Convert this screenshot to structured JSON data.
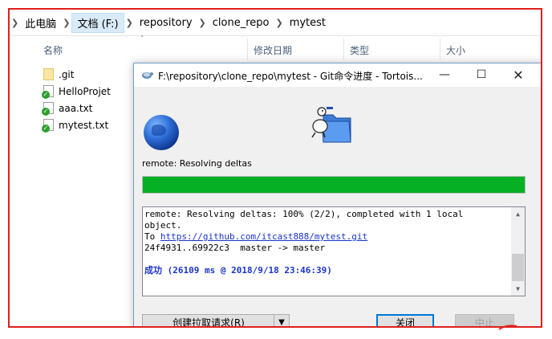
{
  "explorer": {
    "breadcrumbs": [
      "此电脑",
      "文档 (F:)",
      "repository",
      "clone_repo",
      "mytest"
    ],
    "columns": {
      "name": "名称",
      "date": "修改日期",
      "type": "类型",
      "size": "大小"
    },
    "files": [
      {
        "name": ".git",
        "icon": "folder-icon"
      },
      {
        "name": "HelloProjet",
        "icon": "file-ok-icon"
      },
      {
        "name": "aaa.txt",
        "icon": "file-ok-icon"
      },
      {
        "name": "mytest.txt",
        "icon": "file-ok-icon"
      }
    ]
  },
  "dialog": {
    "title": "F:\\repository\\clone_repo\\mytest - Git命令进度 - Tortois...",
    "status": "remote: Resolving deltas",
    "progress": 1.0,
    "log": {
      "line1": "remote: Resolving deltas: 100% (2/2), completed with 1 local",
      "line2": "object.",
      "line3_prefix": "To ",
      "line3_link": "https://github.com/itcast888/mytest.git",
      "line4": "24f4931..69922c3  master -> master",
      "success": "成功 (26109 ms @ 2018/9/18 23:46:39)"
    },
    "buttons": {
      "pull_request": "创建拉取请求(R)",
      "close": "关闭",
      "abort": "中止"
    }
  },
  "colors": {
    "frame": "#e0201c",
    "progress": "#06b025",
    "link": "#1a33cc"
  }
}
